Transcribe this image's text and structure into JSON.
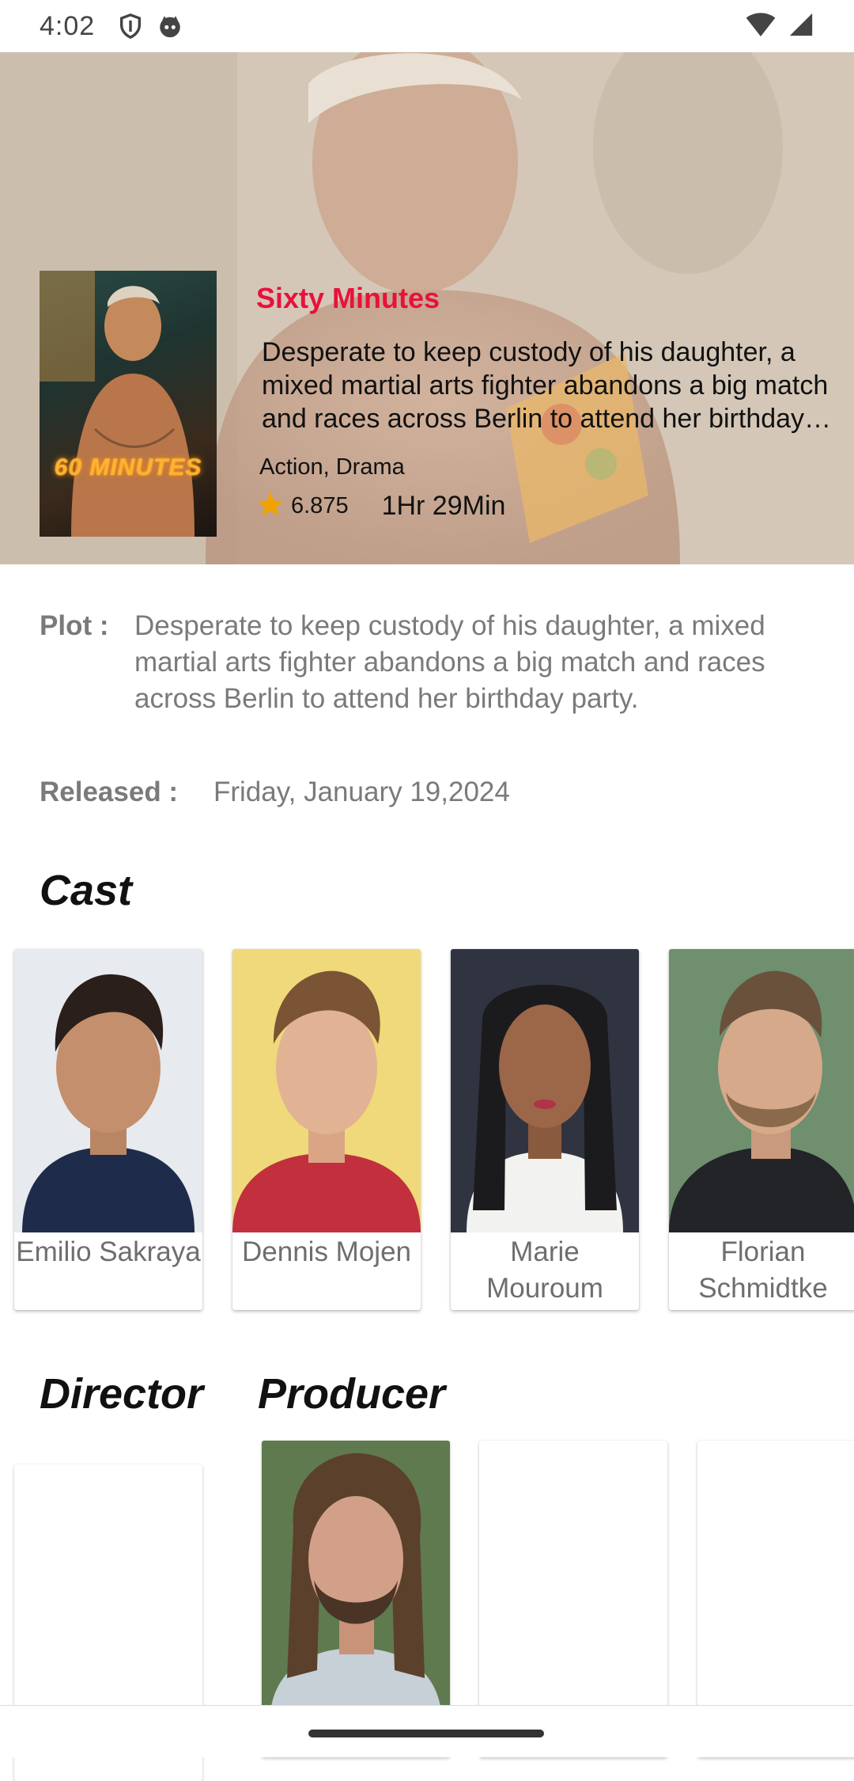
{
  "status_bar": {
    "time": "4:02",
    "icons": [
      "shield-icon",
      "cat-face-icon",
      "wifi-icon",
      "cell-signal-icon"
    ]
  },
  "movie": {
    "title": "Sixty Minutes",
    "poster_title": "60 MINUTES",
    "overview_short": "Desperate to keep custody of his daughter, a mixed martial arts fighter abandons a big match and races across Berlin to attend her birthday party.",
    "genres": "Action, Drama",
    "rating": "6.875",
    "runtime": "1Hr 29Min"
  },
  "details": {
    "plot_label": "Plot :",
    "plot_text": "Desperate to keep custody of his daughter, a mixed martial arts fighter abandons a big match and races across Berlin to attend her birthday party.",
    "released_label": "Released :",
    "released_value": "Friday, January 19,2024"
  },
  "cast": {
    "heading": "Cast",
    "members": [
      {
        "name": "Emilio Sakraya"
      },
      {
        "name": "Dennis Mojen"
      },
      {
        "name": "Marie Mouroum"
      },
      {
        "name": "Florian Schmidtke"
      }
    ]
  },
  "crew": {
    "director_heading": "Director",
    "producer_heading": "Producer"
  },
  "colors": {
    "accent": "#e8113c",
    "star": "#f2a200",
    "label": "#7a7a7a"
  }
}
